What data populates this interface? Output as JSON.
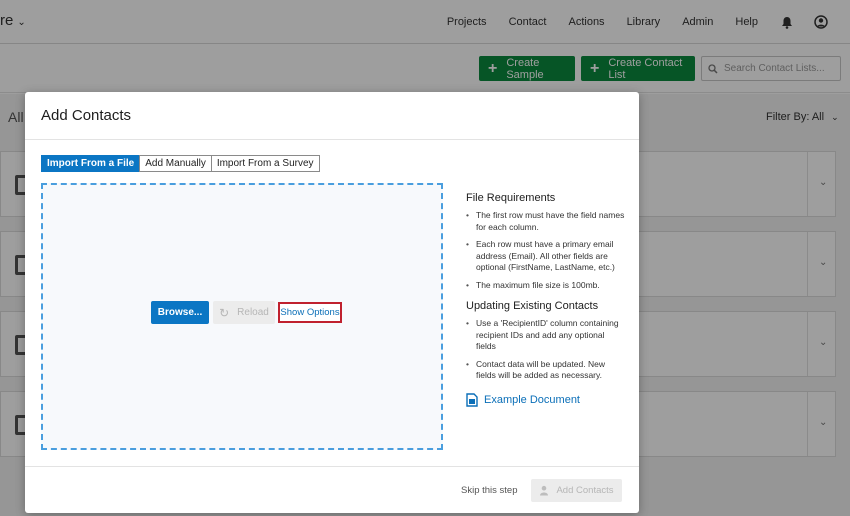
{
  "app": {
    "brand_fragment": "re",
    "brand_chevron": "⌄"
  },
  "nav": {
    "links": [
      "Projects",
      "Contact",
      "Actions",
      "Library",
      "Admin",
      "Help"
    ],
    "bell_icon": "bell-icon",
    "user_icon": "user-circle-icon"
  },
  "toolbar": {
    "create_sample_label": "Create Sample",
    "create_contact_list_label": "Create Contact List",
    "search_placeholder": "Search Contact Lists...",
    "accent_green": "#0b8a3e"
  },
  "background_page": {
    "all_label": "All",
    "filter_label": "Filter By: All",
    "filter_chevron": "⌄",
    "card_chevron": "⌄"
  },
  "modal": {
    "title": "Add Contacts",
    "tabs": [
      {
        "label": "Import From a File",
        "active": true
      },
      {
        "label": "Add Manually",
        "active": false
      },
      {
        "label": "Import From a Survey",
        "active": false
      }
    ],
    "browse_label": "Browse...",
    "reload_label": "Reload",
    "show_options_label": "Show Options",
    "file_requirements": {
      "heading": "File Requirements",
      "items": [
        "The first row must have the field names for each column.",
        "Each row must have a primary email address (Email). All other fields are optional (FirstName, LastName, etc.)",
        "The maximum file size is 100mb."
      ]
    },
    "updating": {
      "heading": "Updating Existing Contacts",
      "items": [
        "Use a 'RecipientID' column containing recipient IDs and add any optional fields",
        "Contact data will be updated. New fields will be added as necessary."
      ]
    },
    "example_document_label": "Example Document",
    "skip_label": "Skip this step",
    "add_contacts_label": "Add Contacts",
    "accent_blue": "#0b76c4",
    "highlight_red": "#c0212e"
  }
}
